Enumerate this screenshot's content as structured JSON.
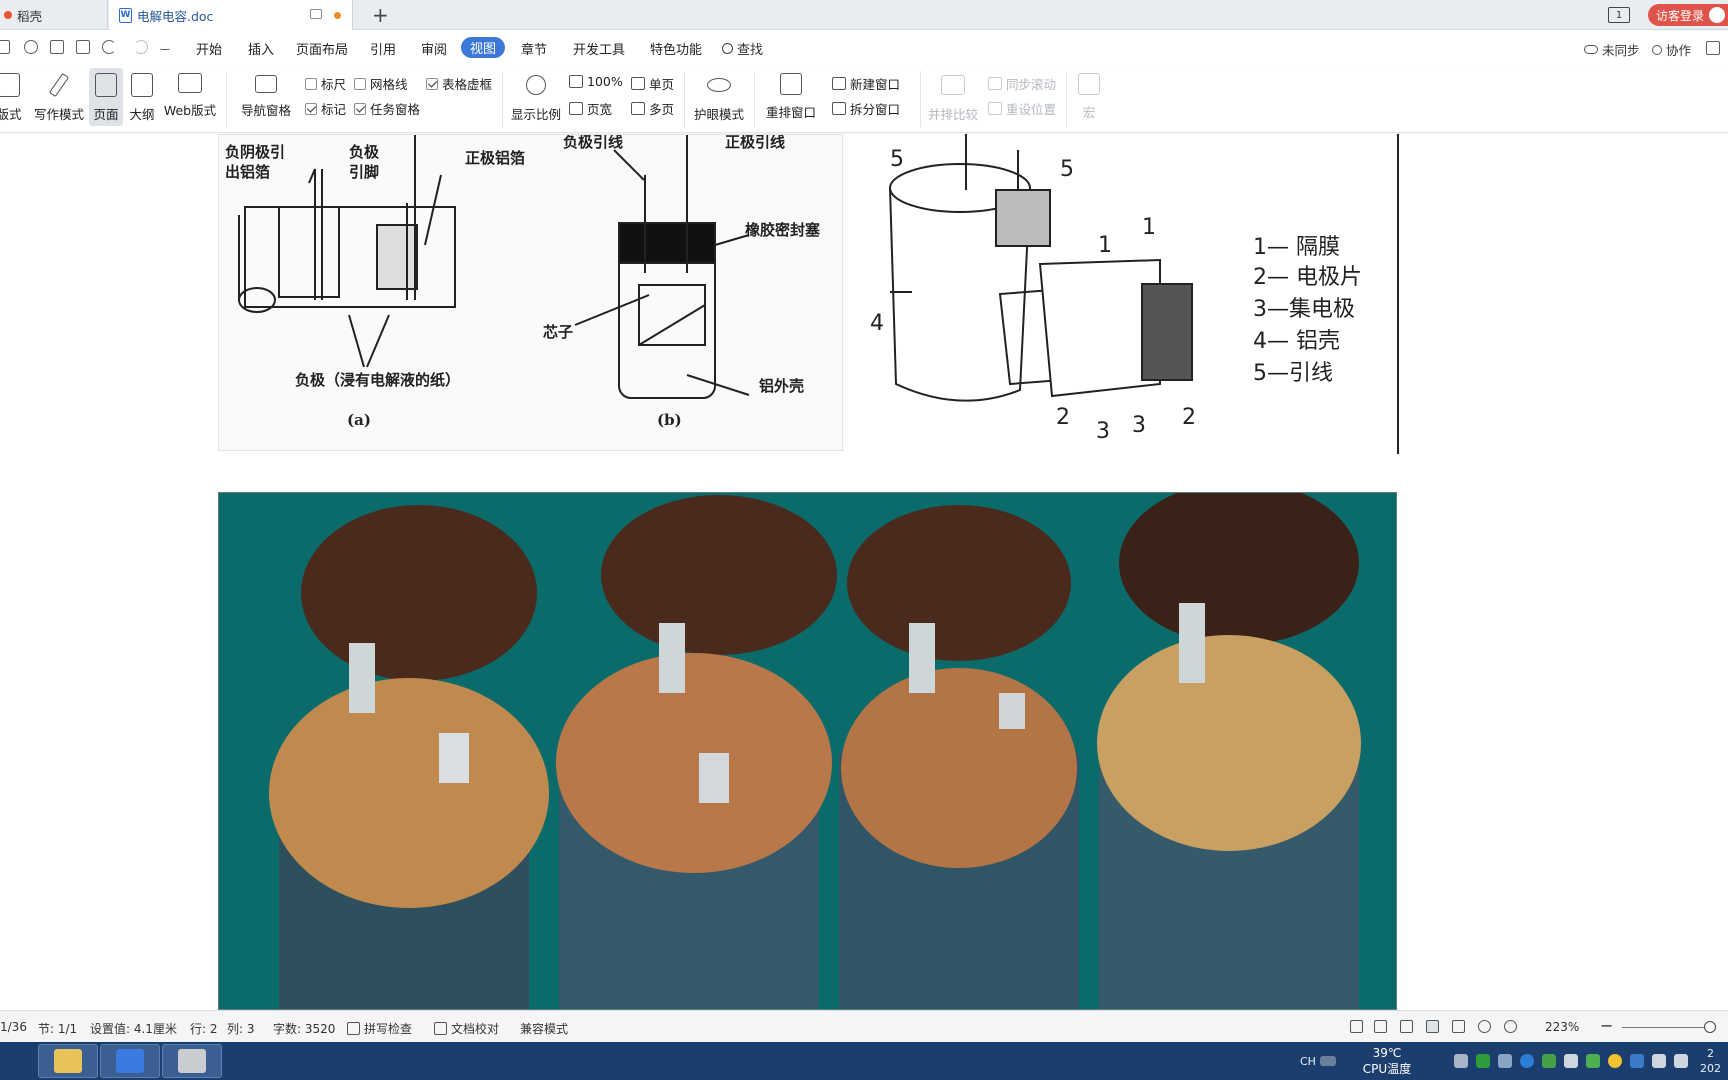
{
  "tabs": {
    "home_label": "稻壳",
    "doc_label": "电解电容.doc",
    "add_label": "+",
    "window_badge": "1",
    "visitor_label": "访客登录"
  },
  "menu": {
    "items": [
      "开始",
      "插入",
      "页面布局",
      "引用",
      "审阅",
      "视图",
      "章节",
      "开发工具",
      "特色功能"
    ],
    "active": "视图",
    "search_label": "查找",
    "sync_label": "未同步",
    "collab_label": "协作"
  },
  "ribbon": {
    "view_modes": [
      "版式",
      "写作模式",
      "页面",
      "大纲",
      "Web版式"
    ],
    "nav_pane": "导航窗格",
    "checkboxes": [
      {
        "label": "标尺",
        "checked": false
      },
      {
        "label": "网格线",
        "checked": false
      },
      {
        "label": "表格虚框",
        "checked": true
      },
      {
        "label": "标记",
        "checked": true
      },
      {
        "label": "任务窗格",
        "checked": true
      }
    ],
    "display_ratio": "显示比例",
    "zoom_100": "100%",
    "page_width": "页宽",
    "single_page": "单页",
    "multi_page": "多页",
    "eye_mode": "护眼模式",
    "rearrange": "重排窗口",
    "new_window": "新建窗口",
    "split_window": "拆分窗口",
    "side_by_side": "并排比较",
    "sync_scroll": "同步滚动",
    "reset_pos": "重设位置",
    "macro": "宏"
  },
  "diagram_left": {
    "labels": [
      "负阴极引",
      "出铝箔",
      "负极",
      "引脚",
      "正极铝箔",
      "负极（浸有电解液的纸）",
      "(a)",
      "负极引线",
      "正极引线",
      "橡胶密封塞",
      "芯子",
      "铝外壳",
      "(b)"
    ]
  },
  "diagram_right": {
    "legend": [
      "1— 隔膜",
      "2— 电极片",
      "3—集电极",
      "4— 铝壳",
      "5—引线"
    ],
    "numbers": [
      "5",
      "5",
      "1",
      "1",
      "4",
      "2",
      "3",
      "3",
      "2"
    ]
  },
  "status": {
    "page": "1/36",
    "section": "节: 1/1",
    "setting": "设置值: 4.1厘米",
    "row": "行: 2",
    "col": "列: 3",
    "words": "字数: 3520",
    "spell": "拼写检查",
    "proof": "文档校对",
    "compat": "兼容模式",
    "zoom": "223%"
  },
  "taskbar": {
    "temp": "39℃",
    "cpu_label": "CPU温度",
    "ime": "CH",
    "clock_top": "2",
    "clock_bottom": "202"
  },
  "colors": {
    "accent": "#3b78d8",
    "visitor": "#e0534a",
    "taskbar": "#1c3e6e",
    "photo_bg": "#0b6b6a"
  }
}
